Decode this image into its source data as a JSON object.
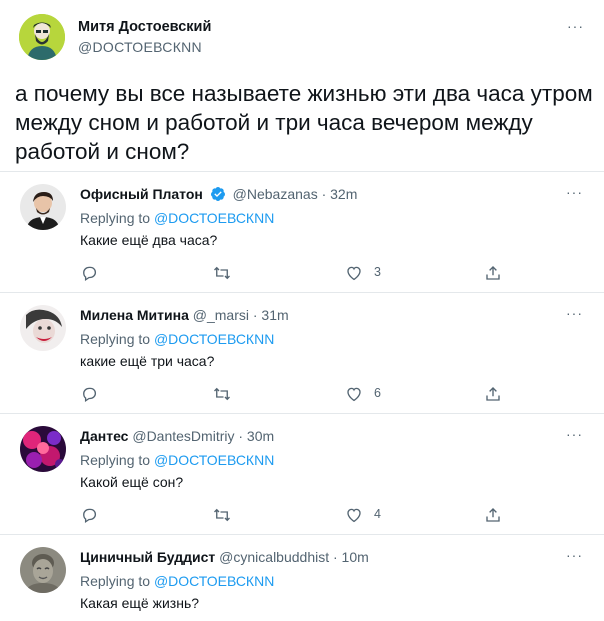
{
  "main_tweet": {
    "author_name": "Митя Достоевский",
    "author_handle": "@DОСТОЕВСКNN",
    "more_label": "···",
    "text": "а почему вы все называете жизнью эти два часа утром между сном и работой и три часа вечером между работой и сном?"
  },
  "replies": [
    {
      "name": "Офисный Платон",
      "verified": true,
      "handle": "@Nebazanas",
      "time": "· 32m",
      "replying_prefix": "Replying to ",
      "replying_to": "@DОСТОЕВСКNN",
      "text": "Какие ещё два часа?",
      "likes": "3",
      "more_label": "···"
    },
    {
      "name": "Милена Митина",
      "verified": false,
      "handle": "@_marsi",
      "time": "· 31m",
      "replying_prefix": "Replying to ",
      "replying_to": "@DОСТОЕВСКNN",
      "text": "какие ещё три часа?",
      "likes": "6",
      "more_label": "···"
    },
    {
      "name": "Дантес",
      "verified": false,
      "handle": "@DantesDmitriy",
      "time": "· 30m",
      "replying_prefix": "Replying to ",
      "replying_to": "@DОСТОЕВСКNN",
      "text": "Какой ещё сон?",
      "likes": "4",
      "more_label": "···"
    },
    {
      "name": "Циничный Буддист",
      "verified": false,
      "handle": "@cynicalbuddhist",
      "time": "· 10m",
      "replying_prefix": "Replying to ",
      "replying_to": "@DОСТОЕВСКNN",
      "text": "Какая ещё жизнь?",
      "more_label": "···"
    }
  ],
  "icons": {
    "reply": "speech-bubble-icon",
    "retweet": "retweet-arrows-icon",
    "like": "heart-icon",
    "share": "share-upload-icon",
    "verified": "verified-badge-icon"
  },
  "colors": {
    "link": "#1d9bf0",
    "secondary_text": "#536471",
    "primary_text": "#0f1419",
    "divider": "#e4e8eb"
  }
}
